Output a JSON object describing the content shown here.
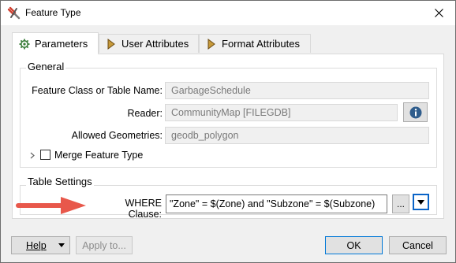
{
  "window": {
    "title": "Feature Type",
    "title_icon": "fme-transformer-icon",
    "close_icon": "close-icon"
  },
  "tabs": [
    {
      "label": "Parameters",
      "icon": "gear-icon",
      "active": true
    },
    {
      "label": "User Attributes",
      "icon": "arrow-right-icon",
      "active": false
    },
    {
      "label": "Format Attributes",
      "icon": "arrow-right-icon",
      "active": false
    }
  ],
  "general": {
    "title": "General",
    "feature_class_label": "Feature Class or Table Name:",
    "feature_class_value": "GarbageSchedule",
    "reader_label": "Reader:",
    "reader_value": "CommunityMap [FILEGDB]",
    "allowed_geometries_label": "Allowed Geometries:",
    "allowed_geometries_value": "geodb_polygon",
    "merge_label": "Merge Feature Type",
    "merge_checked": false
  },
  "table_settings": {
    "title": "Table Settings",
    "where_label": "WHERE Clause:",
    "where_value": "\"Zone\" = $(Zone) and \"Subzone\" = $(Subzone)",
    "ellipsis_label": "..."
  },
  "footer": {
    "help_label": "Help",
    "apply_label": "Apply to...",
    "ok_label": "OK",
    "cancel_label": "Cancel"
  },
  "colors": {
    "accent": "#0a64c8",
    "annotation_arrow": "#e8584b",
    "info_icon": "#2f5d8c"
  }
}
